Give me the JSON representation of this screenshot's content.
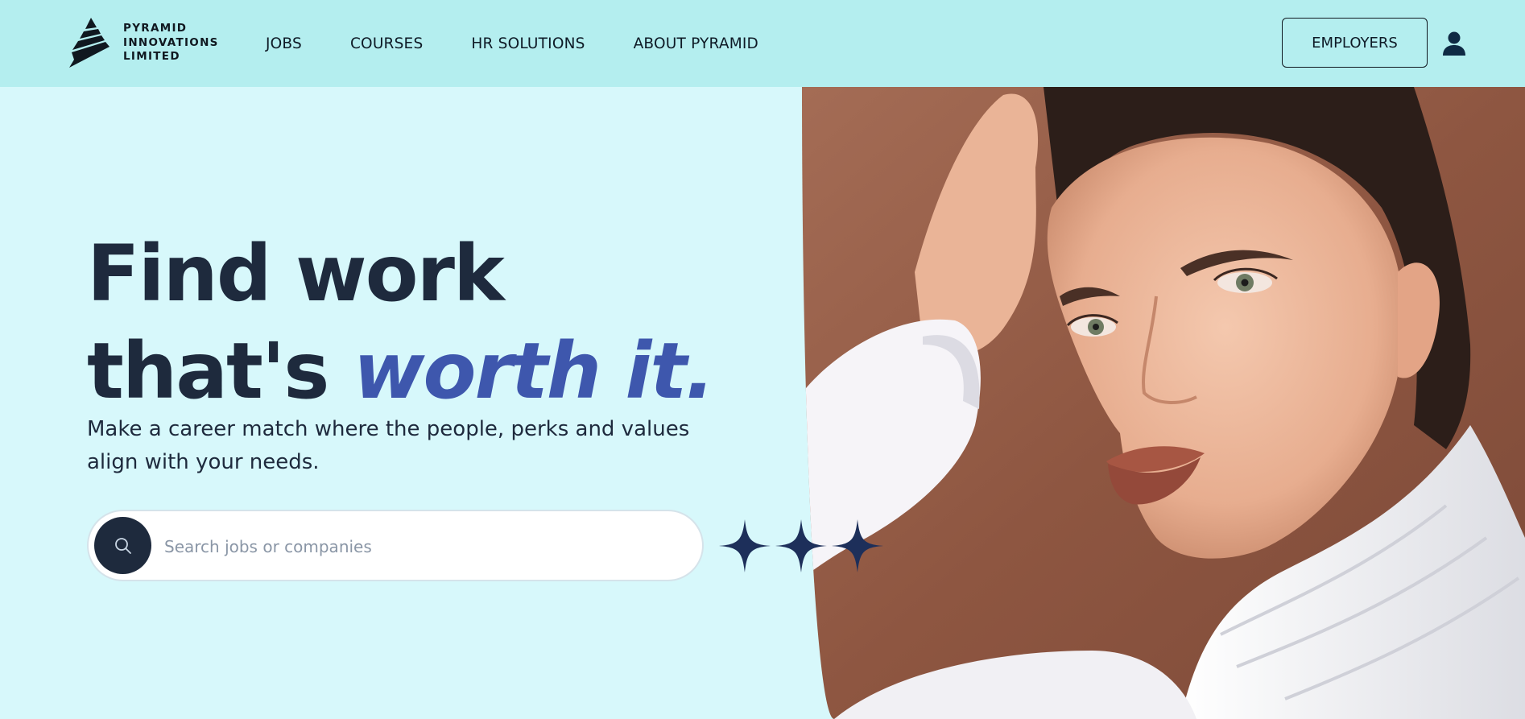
{
  "brand": {
    "lines": [
      "PYRAMID",
      "INNOVATIONS",
      "LIMITED"
    ],
    "icon": "pyramid-logo-icon"
  },
  "nav": {
    "items": [
      {
        "label": "JOBS"
      },
      {
        "label": "COURSES"
      },
      {
        "label": "HR SOLUTIONS"
      },
      {
        "label": "ABOUT PYRAMID"
      }
    ]
  },
  "header": {
    "employers_label": "EMPLOYERS",
    "account_icon": "user-icon"
  },
  "hero": {
    "headline_line1": "Find work",
    "headline_line2_plain": "that's ",
    "headline_line2_accent": "worth it.",
    "subtext": "Make a career match where the people, perks and values align with your needs.",
    "search": {
      "placeholder": "Search jobs or companies",
      "button_icon": "search-icon"
    },
    "decoration_icon": "sparkle-icon",
    "photo": "portrait-photo"
  },
  "colors": {
    "header_bg": "#b4eeef",
    "page_bg": "#d7f8fb",
    "text_dark": "#1e2a3d",
    "accent": "#3e57ad",
    "photo_bg": "#8f5a45"
  }
}
